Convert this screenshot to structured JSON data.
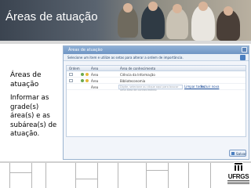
{
  "banner": {
    "title": "Áreas de atuação"
  },
  "side": {
    "title": "Áreas de atuação",
    "description": "Informar as grade(s) área(s) e as subárea(s) de atuação."
  },
  "window": {
    "title": "Áreas de atuação",
    "instruction": "Selecione um item e utilize as setas para alterar a ordem de importância.",
    "columns": {
      "order": "Ordem",
      "area": "Área",
      "knowledge": "Área de conhecimento"
    },
    "rows": [
      {
        "area": "Área",
        "knowledge": "Ciência da Informação"
      },
      {
        "area": "Área",
        "knowledge": "Biblioteconomia"
      }
    ],
    "new_row": {
      "area": "Área",
      "placeholder": "Digite, selecione ou clique aqui para buscar uma área de conhecimento",
      "clear_link": "Limpar todos",
      "include_link": "Incluir nova"
    },
    "save_label": "Salvar"
  },
  "logo": {
    "text": "UFRGS"
  },
  "colors": {
    "accent": "#4b7fc0",
    "banner_dark": "#3b4450",
    "window_border": "#9ab3d0"
  }
}
